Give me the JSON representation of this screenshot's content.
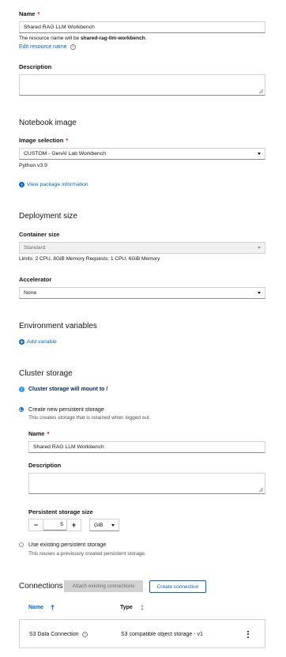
{
  "name_field": {
    "label": "Name",
    "required": "*",
    "value": "Shared RAG LLM Workbench",
    "resource_prefix": "The resource name will be ",
    "resource_name": "shared-rag-llm-workbench",
    "resource_suffix": ".",
    "edit_link": "Edit resource name"
  },
  "description_field": {
    "label": "Description"
  },
  "notebook_image": {
    "heading": "Notebook image",
    "selection_label": "Image selection",
    "required": "*",
    "selected": "CUSTOM - GenAI Lab Workbench",
    "python_version": "Python v3.9",
    "package_link": "View package information"
  },
  "deployment": {
    "heading": "Deployment size",
    "container_label": "Container size",
    "container_value": "Standard",
    "limits_text": "Limits: 2 CPU, 8GiB Memory Requests: 1 CPU, 6GiB Memory",
    "accelerator_label": "Accelerator",
    "accelerator_value": "None"
  },
  "env_vars": {
    "heading": "Environment variables",
    "add_link": "Add variable"
  },
  "cluster_storage": {
    "heading": "Cluster storage",
    "info_text": "Cluster storage will mount to /",
    "new_option": "Create new persistent storage",
    "new_desc": "This creates storage that is retained when logged out.",
    "name_label": "Name",
    "required": "*",
    "name_value": "Shared RAG LLM Workbench",
    "description_label": "Description",
    "size_label": "Persistent storage size",
    "size_minus": "−",
    "size_value": "5",
    "size_plus": "+",
    "size_unit": "GiB",
    "existing_option": "Use existing persistent storage",
    "existing_desc": "This reuses a previously created persistent storage."
  },
  "connections": {
    "heading": "Connections",
    "attach_button": "Attach existing connections",
    "create_button": "Create connection",
    "columns": [
      "Name",
      "Type"
    ],
    "rows": [
      {
        "name": "S3 Data Connection",
        "type": "S3 compatible object storage - v1"
      }
    ]
  },
  "colors": {
    "accent": "#0066cc",
    "required": "#c9190b",
    "disabled_bg": "#f0f0f0"
  }
}
